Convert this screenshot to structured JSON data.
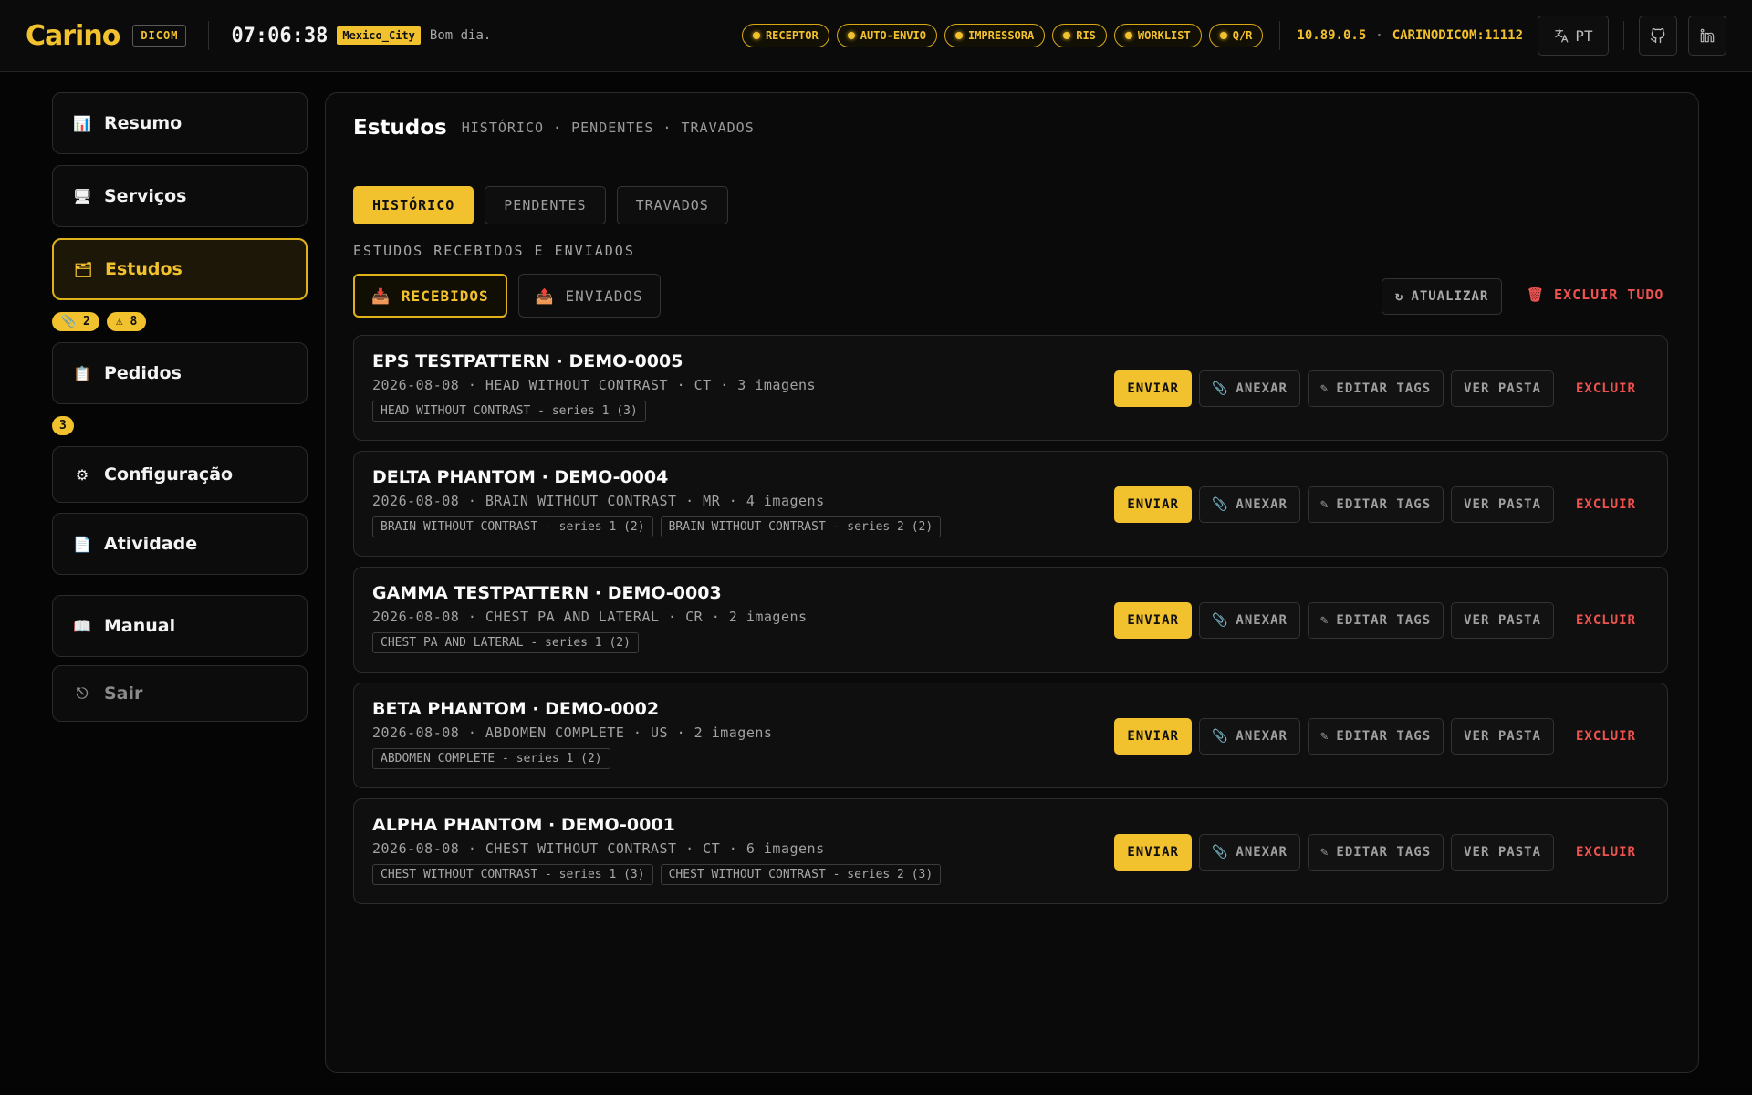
{
  "header": {
    "logo": "Carino",
    "logo_tag": "DICOM",
    "clock": "07:06:38",
    "timezone": "Mexico_City",
    "greeting": "Bom dia.",
    "services": [
      "RECEPTOR",
      "AUTO-ENVIO",
      "IMPRESSORA",
      "RIS",
      "WORKLIST",
      "Q/R"
    ],
    "ip": "10.89.0.5",
    "host_separator": "·",
    "ae_port": "CARINODICOM:11112",
    "language": "PT"
  },
  "sidebar": {
    "resumo": "Resumo",
    "servicos": "Serviços",
    "estudos": "Estudos",
    "estudos_badge_attach": "📎 2",
    "estudos_badge_warn": "⚠ 8",
    "pedidos": "Pedidos",
    "pedidos_badge": "3",
    "configuracao": "Configuração",
    "atividade": "Atividade",
    "manual": "Manual",
    "sair": "Sair"
  },
  "main": {
    "title": "Estudos",
    "subtitle": "HISTÓRICO · PENDENTES · TRAVADOS",
    "tabs": [
      "HISTÓRICO",
      "PENDENTES",
      "TRAVADOS"
    ],
    "section_label": "ESTUDOS RECEBIDOS E ENVIADOS",
    "subtabs": [
      "RECEBIDOS",
      "ENVIADOS"
    ],
    "refresh_label": "ATUALIZAR",
    "delete_all_label": "EXCLUIR TUDO",
    "actions": {
      "send": "ENVIAR",
      "attach": "ANEXAR",
      "edit_tags": "EDITAR TAGS",
      "view_folder": "VER PASTA",
      "delete": "EXCLUIR"
    },
    "studies": [
      {
        "title": "EPS TESTPATTERN · DEMO-0005",
        "meta": "2026-08-08 · HEAD WITHOUT CONTRAST · CT · 3 imagens",
        "series": [
          "HEAD WITHOUT CONTRAST - series 1 (3)"
        ]
      },
      {
        "title": "DELTA PHANTOM · DEMO-0004",
        "meta": "2026-08-08 · BRAIN WITHOUT CONTRAST · MR · 4 imagens",
        "series": [
          "BRAIN WITHOUT CONTRAST - series 1 (2)",
          "BRAIN WITHOUT CONTRAST - series 2 (2)"
        ]
      },
      {
        "title": "GAMMA TESTPATTERN · DEMO-0003",
        "meta": "2026-08-08 · CHEST PA AND LATERAL · CR · 2 imagens",
        "series": [
          "CHEST PA AND LATERAL - series 1 (2)"
        ]
      },
      {
        "title": "BETA PHANTOM · DEMO-0002",
        "meta": "2026-08-08 · ABDOMEN COMPLETE · US · 2 imagens",
        "series": [
          "ABDOMEN COMPLETE - series 1 (2)"
        ]
      },
      {
        "title": "ALPHA PHANTOM · DEMO-0001",
        "meta": "2026-08-08 · CHEST WITHOUT CONTRAST · CT · 6 imagens",
        "series": [
          "CHEST WITHOUT CONTRAST - series 1 (3)",
          "CHEST WITHOUT CONTRAST - series 2 (3)"
        ]
      }
    ]
  },
  "colors": {
    "accent": "#f2c12e",
    "danger": "#ef5350",
    "background": "#050505"
  }
}
